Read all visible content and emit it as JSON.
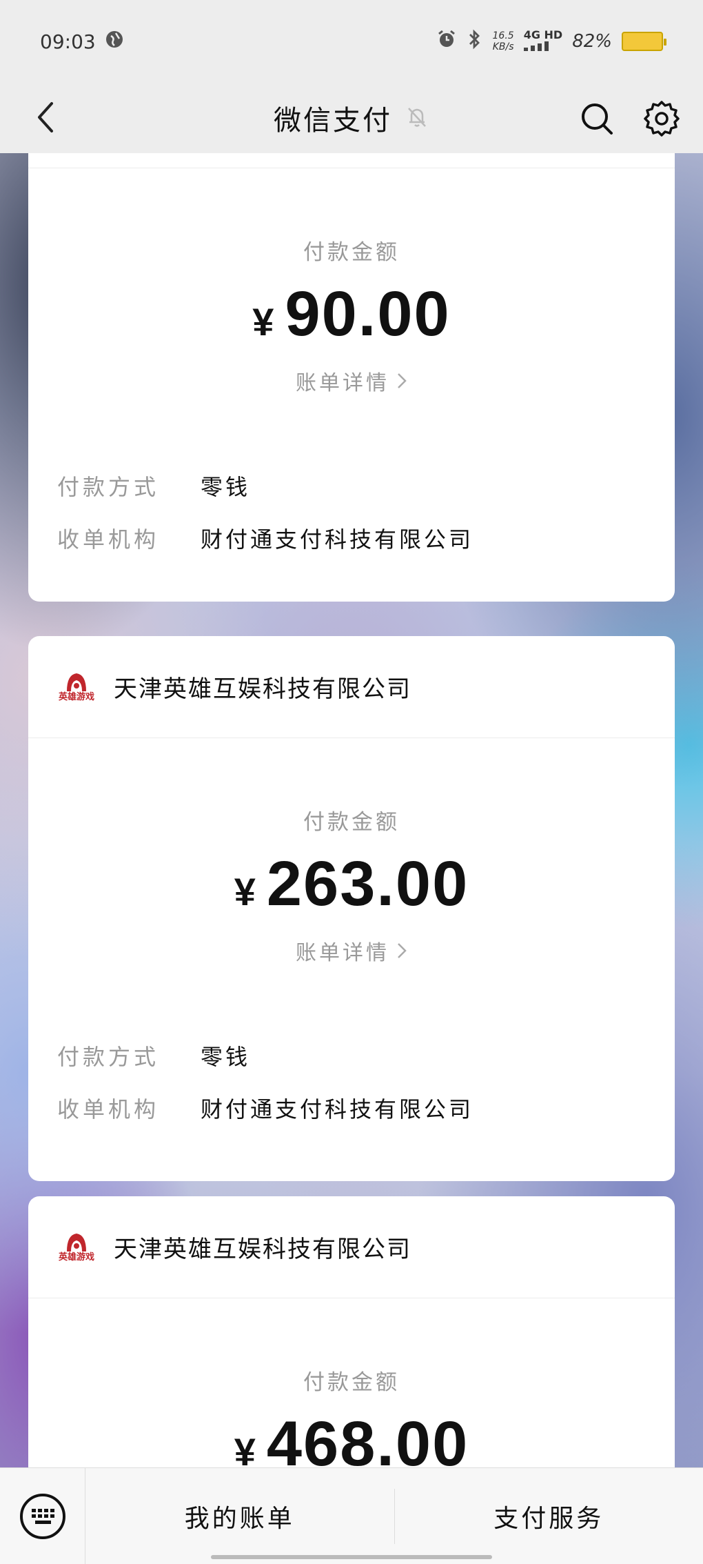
{
  "status_bar": {
    "time": "09:03",
    "net_speed": "16.5",
    "net_unit": "KB/s",
    "signal": "4G HD",
    "battery": "82%"
  },
  "header": {
    "title": "微信支付"
  },
  "cards": [
    {
      "amount_label": "付款金额",
      "currency": "¥",
      "amount": "90.00",
      "detail_link": "账单详情",
      "payment_method_label": "付款方式",
      "payment_method": "零钱",
      "acquirer_label": "收单机构",
      "acquirer": "财付通支付科技有限公司"
    },
    {
      "merchant": "天津英雄互娱科技有限公司",
      "merchant_logo_text": "英雄游戏",
      "amount_label": "付款金额",
      "currency": "¥",
      "amount": "263.00",
      "detail_link": "账单详情",
      "payment_method_label": "付款方式",
      "payment_method": "零钱",
      "acquirer_label": "收单机构",
      "acquirer": "财付通支付科技有限公司"
    },
    {
      "merchant": "天津英雄互娱科技有限公司",
      "merchant_logo_text": "英雄游戏",
      "amount_label": "付款金额",
      "currency": "¥",
      "amount": "468.00"
    }
  ],
  "bottom_menu": {
    "my_bills": "我的账单",
    "pay_services": "支付服务"
  },
  "colors": {
    "accent_logo": "#c0262c",
    "background": "#ededed"
  }
}
